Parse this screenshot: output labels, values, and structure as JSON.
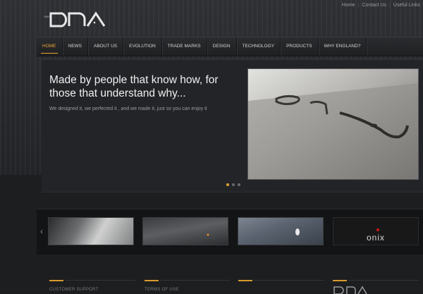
{
  "header": {
    "logo_text": "DNA",
    "logo_small_text": "ONIX",
    "util_links": [
      "Home",
      "Contact Us",
      "Useful Links"
    ]
  },
  "nav": {
    "items": [
      "HOME",
      "NEWS",
      "ABOUT US",
      "EVOLUTION",
      "TRADE MARKS",
      "DESIGN",
      "TECHNOLOGY",
      "PRODUCTS",
      "WHY ENGLAND?"
    ],
    "active_index": 0,
    "accent_color": "#e6a431"
  },
  "hero": {
    "title": "Made by people that know how, for those that understand why...",
    "subtitle": "We designed it, we perfected it , and we made it, just so you can enjoy it",
    "slides": 3,
    "active_slide": 0
  },
  "carousel": {
    "thumbnails": [
      "product-detail-1",
      "product-detail-2",
      "product-detail-3",
      "onix-logo"
    ],
    "onix_label": "onix"
  },
  "footer": {
    "labels": [
      "CUSTOMER SUPPORT",
      "TERMS OF USE",
      "",
      ""
    ],
    "footer_logo_text": "DNA"
  }
}
